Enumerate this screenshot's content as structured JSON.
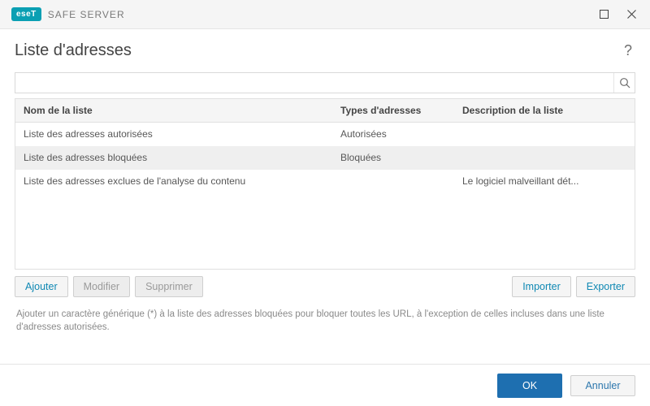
{
  "brand": {
    "word": "eseT",
    "product": "SAFE SERVER"
  },
  "title": "Liste d'adresses",
  "search": {
    "value": "",
    "placeholder": ""
  },
  "table": {
    "headers": {
      "name": "Nom de la liste",
      "type": "Types d'adresses",
      "desc": "Description de la liste"
    },
    "rows": [
      {
        "name": "Liste des adresses autorisées",
        "type": "Autorisées",
        "desc": "",
        "selected": false
      },
      {
        "name": "Liste des adresses bloquées",
        "type": "Bloquées",
        "desc": "",
        "selected": true
      },
      {
        "name": "Liste des adresses exclues de l'analyse du contenu",
        "type": "",
        "desc": "Le logiciel malveillant dét...",
        "selected": false
      }
    ]
  },
  "buttons": {
    "add": "Ajouter",
    "edit": "Modifier",
    "delete": "Supprimer",
    "import": "Importer",
    "export": "Exporter",
    "ok": "OK",
    "cancel": "Annuler"
  },
  "hint": "Ajouter un caractère générique (*) à la liste des adresses bloquées pour bloquer toutes les URL, à l'exception de celles incluses dans une liste d'adresses autorisées.",
  "help_symbol": "?"
}
